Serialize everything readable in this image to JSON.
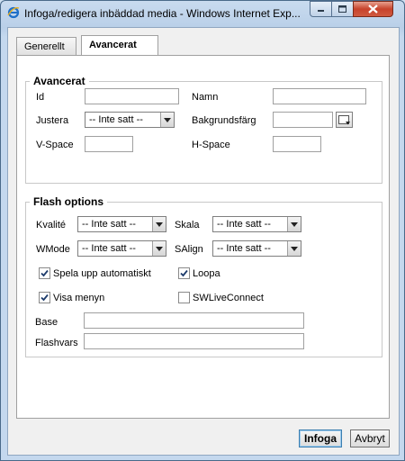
{
  "window": {
    "title": "Infoga/redigera inbäddad media - Windows Internet Exp..."
  },
  "tabs": [
    {
      "label": "Generellt",
      "active": false
    },
    {
      "label": "Avancerat",
      "active": true
    }
  ],
  "advanced": {
    "legend": "Avancerat",
    "id_label": "Id",
    "id_value": "",
    "name_label": "Namn",
    "name_value": "",
    "align_label": "Justera",
    "align_value": "-- Inte satt --",
    "bgcolor_label": "Bakgrundsfärg",
    "bgcolor_value": "",
    "vspace_label": "V-Space",
    "vspace_value": "",
    "hspace_label": "H-Space",
    "hspace_value": ""
  },
  "flash": {
    "legend": "Flash options",
    "quality_label": "Kvalité",
    "quality_value": "-- Inte satt --",
    "scale_label": "Skala",
    "scale_value": "-- Inte satt --",
    "wmode_label": "WMode",
    "wmode_value": "-- Inte satt --",
    "salign_label": "SAlign",
    "salign_value": "-- Inte satt --",
    "autoplay_label": "Spela upp automatiskt",
    "autoplay_checked": true,
    "loop_label": "Loopa",
    "loop_checked": true,
    "menu_label": "Visa menyn",
    "menu_checked": true,
    "swlive_label": "SWLiveConnect",
    "swlive_checked": false,
    "base_label": "Base",
    "base_value": "",
    "flashvars_label": "Flashvars",
    "flashvars_value": ""
  },
  "buttons": {
    "insert": "Infoga",
    "cancel": "Avbryt"
  },
  "icons": [
    "ie-icon",
    "minimize-icon",
    "maximize-icon",
    "close-icon",
    "dropdown-arrow-icon",
    "color-picker-icon",
    "checkmark-icon"
  ]
}
